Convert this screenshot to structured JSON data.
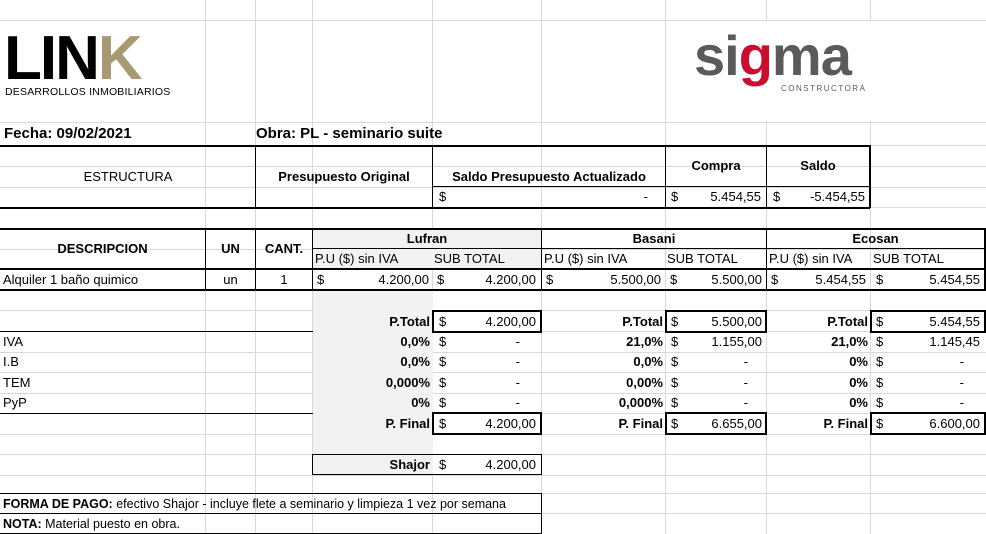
{
  "header": {
    "logo_left": {
      "main": "LIN",
      "accent": "K",
      "subtitle": "DESARROLLOS INMOBILIARIOS"
    },
    "logo_right": {
      "part1": "si",
      "accent": "g",
      "part2": "ma",
      "subtitle": "CONSTRUCTORA"
    },
    "fecha": "Fecha: 09/02/2021",
    "obra": "Obra:  PL - seminario suite"
  },
  "summary": {
    "estructura": "ESTRUCTURA",
    "presupuesto_original": "Presupuesto Original",
    "saldo_presupuesto": "Saldo Presupuesto Actualizado",
    "saldo_presupuesto_currency": "$",
    "saldo_presupuesto_value": "-",
    "compra": "Compra",
    "compra_currency": "$",
    "compra_value": "5.454,55",
    "saldo": "Saldo",
    "saldo_currency": "$",
    "saldo_value": "-5.454,55"
  },
  "table": {
    "col_descripcion": "DESCRIPCION",
    "col_un": "UN",
    "col_cant": "CANT.",
    "providers": [
      {
        "name": "Lufran",
        "pu": "P.U ($) sin IVA",
        "sub": "SUB TOTAL"
      },
      {
        "name": "Basani",
        "pu": "P.U ($) sin IVA",
        "sub": "SUB TOTAL"
      },
      {
        "name": "Ecosan",
        "pu": "P.U ($) sin IVA",
        "sub": "SUB TOTAL"
      }
    ],
    "item": {
      "descripcion": "Alquiler 1 baño quimico",
      "un": "un",
      "cant": "1",
      "values": [
        {
          "pu_cur": "$",
          "pu": "4.200,00",
          "sub_cur": "$",
          "sub": "4.200,00"
        },
        {
          "pu_cur": "$",
          "pu": "5.500,00",
          "sub_cur": "$",
          "sub": "5.500,00"
        },
        {
          "pu_cur": "$",
          "pu": "5.454,55",
          "sub_cur": "$",
          "sub": "5.454,55"
        }
      ]
    }
  },
  "totals": {
    "row_labels": [
      "IVA",
      "I.B",
      "TEM",
      "PyP"
    ],
    "ptotal_label": "P.Total",
    "pfinal_label": "P. Final",
    "currency": "$",
    "providers": [
      {
        "ptotal": "4.200,00",
        "pcts": [
          "0,0%",
          "0,0%",
          "0,000%",
          "0%"
        ],
        "amounts": [
          "-",
          "-",
          "-",
          "-"
        ],
        "pfinal": "4.200,00"
      },
      {
        "ptotal": "5.500,00",
        "pcts": [
          "21,0%",
          "0,0%",
          "0,00%",
          "0,000%"
        ],
        "amounts": [
          "1.155,00",
          "-",
          "-",
          "-"
        ],
        "pfinal": "6.655,00"
      },
      {
        "ptotal": "5.454,55",
        "pcts": [
          "21,0%",
          "0%",
          "0%",
          "0%"
        ],
        "amounts": [
          "1.145,45",
          "-",
          "-",
          "-"
        ],
        "pfinal": "6.600,00"
      }
    ],
    "shajor_label": "Shajor",
    "shajor_currency": "$",
    "shajor_value": "4.200,00"
  },
  "notes": {
    "forma_label": "FORMA DE PAGO:",
    "forma_text": " efectivo Shajor - incluye flete a seminario y limpieza 1 vez por semana",
    "nota_label": "NOTA:",
    "nota_text": " Material puesto en obra."
  }
}
